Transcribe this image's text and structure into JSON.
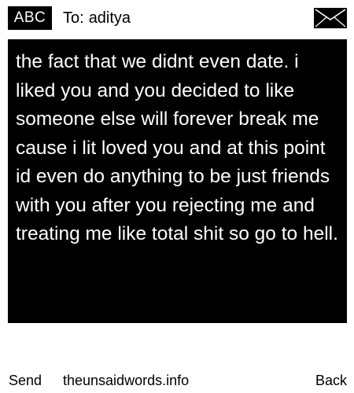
{
  "header": {
    "mode_label": "ABC",
    "recipient_prefix": "To:",
    "recipient_name": "aditya",
    "envelope_icon": "envelope-icon"
  },
  "message": {
    "body": "the fact that we didnt even date. i liked you and you decided to like someone else will forever break me cause i lit loved you and at this point id even do anything to be just friends with you after you rejecting me and treating me like total shit so go to hell."
  },
  "footer": {
    "send_label": "Send",
    "site_label": "theunsaidwords.info",
    "back_label": "Back"
  },
  "colors": {
    "background": "#ffffff",
    "message_background": "#000000",
    "message_text": "#ffffff",
    "text": "#000000"
  }
}
